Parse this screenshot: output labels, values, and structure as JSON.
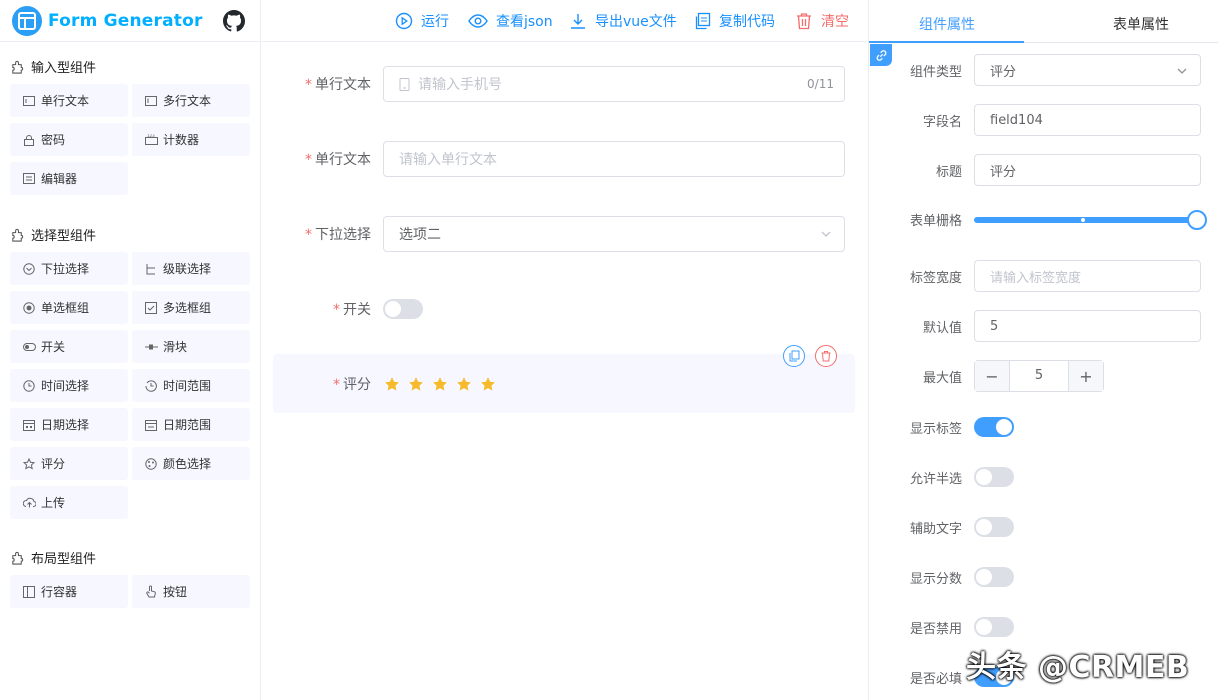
{
  "app": {
    "title": "Form Generator"
  },
  "toolbar": {
    "run": "运行",
    "view_json": "查看json",
    "export_vue": "导出vue文件",
    "copy_code": "复制代码",
    "clear": "清空"
  },
  "sidebar": {
    "groups": [
      {
        "title": "输入型组件",
        "items": [
          {
            "label": "单行文本",
            "icon": "input-icon"
          },
          {
            "label": "多行文本",
            "icon": "textarea-icon"
          },
          {
            "label": "密码",
            "icon": "password-icon"
          },
          {
            "label": "计数器",
            "icon": "number-icon"
          },
          {
            "label": "编辑器",
            "icon": "editor-icon"
          }
        ]
      },
      {
        "title": "选择型组件",
        "items": [
          {
            "label": "下拉选择",
            "icon": "select-icon"
          },
          {
            "label": "级联选择",
            "icon": "cascader-icon"
          },
          {
            "label": "单选框组",
            "icon": "radio-icon"
          },
          {
            "label": "多选框组",
            "icon": "checkbox-icon"
          },
          {
            "label": "开关",
            "icon": "switch-icon"
          },
          {
            "label": "滑块",
            "icon": "slider-icon"
          },
          {
            "label": "时间选择",
            "icon": "time-icon"
          },
          {
            "label": "时间范围",
            "icon": "time-range-icon"
          },
          {
            "label": "日期选择",
            "icon": "date-icon"
          },
          {
            "label": "日期范围",
            "icon": "date-range-icon"
          },
          {
            "label": "评分",
            "icon": "rate-icon"
          },
          {
            "label": "颜色选择",
            "icon": "color-icon"
          },
          {
            "label": "上传",
            "icon": "upload-icon"
          }
        ]
      },
      {
        "title": "布局型组件",
        "items": [
          {
            "label": "行容器",
            "icon": "row-icon"
          },
          {
            "label": "按钮",
            "icon": "button-icon"
          }
        ]
      }
    ]
  },
  "form": {
    "required_mark": "*",
    "fields": [
      {
        "label": "单行文本",
        "placeholder": "请输入手机号",
        "counter": "0/11"
      },
      {
        "label": "单行文本",
        "placeholder": "请输入单行文本"
      },
      {
        "label": "下拉选择",
        "value": "选项二"
      },
      {
        "label": "开关",
        "on": false
      },
      {
        "label": "评分",
        "stars": 5,
        "star_color": "#f7ba2a"
      }
    ]
  },
  "props": {
    "tabs": [
      "组件属性",
      "表单属性"
    ],
    "component_type": {
      "label": "组件类型",
      "value": "评分"
    },
    "field_name": {
      "label": "字段名",
      "value": "field104"
    },
    "title": {
      "label": "标题",
      "value": "评分"
    },
    "grid": {
      "label": "表单栅格",
      "value": 1.0
    },
    "label_width": {
      "label": "标签宽度",
      "placeholder": "请输入标签宽度"
    },
    "default_value": {
      "label": "默认值",
      "value": "5"
    },
    "max_value": {
      "label": "最大值",
      "value": "5",
      "minus": "−",
      "plus": "+"
    },
    "switches": [
      {
        "label": "显示标签",
        "on": true
      },
      {
        "label": "允许半选",
        "on": false
      },
      {
        "label": "辅助文字",
        "on": false
      },
      {
        "label": "显示分数",
        "on": false
      },
      {
        "label": "是否禁用",
        "on": false
      },
      {
        "label": "是否必填",
        "on": true
      }
    ]
  },
  "watermark": "头条 @CRMEB",
  "colors": {
    "primary": "#409eff",
    "danger": "#f56c6c",
    "brand": "#00afff"
  }
}
